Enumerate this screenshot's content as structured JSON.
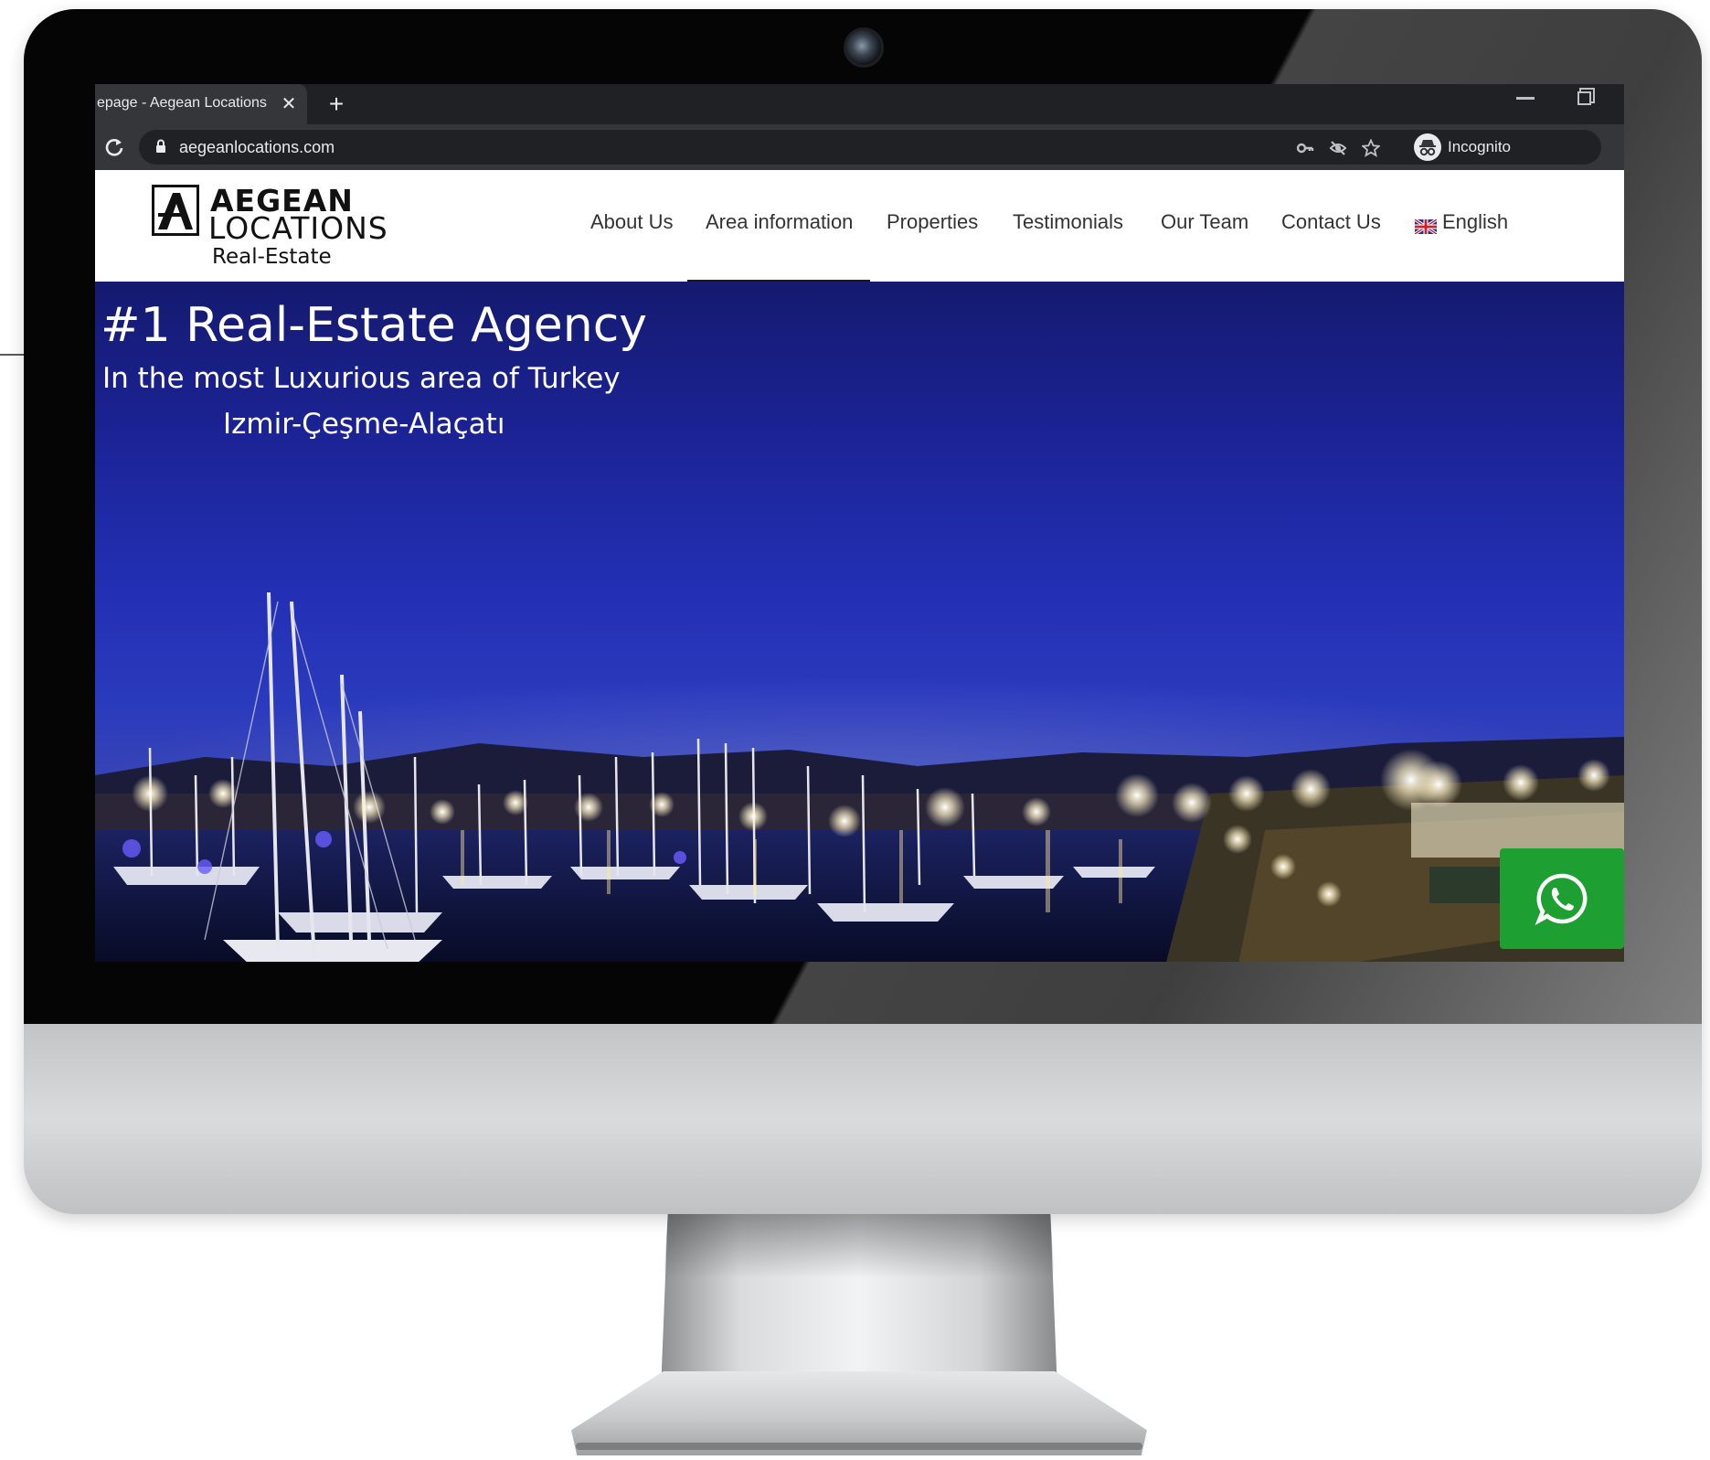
{
  "browser": {
    "tab_title": "epage - Aegean Locations - R",
    "tab_close": "✕",
    "new_tab": "+",
    "url": "aegeanlocations.com",
    "incognito_label": "Incognito",
    "icons": [
      "key-icon",
      "eye-off-icon",
      "star-icon",
      "incognito-icon",
      "reload-icon",
      "lock-icon"
    ]
  },
  "site": {
    "logo": {
      "line1": "AEGEAN",
      "line2": "LOCATIONS",
      "line3": "Real-Estate"
    },
    "nav": [
      {
        "label": "About Us"
      },
      {
        "label": "Area information"
      },
      {
        "label": "Properties"
      },
      {
        "label": "Testimonials"
      },
      {
        "label": "Our Team"
      },
      {
        "label": "Contact Us"
      },
      {
        "label": "English"
      }
    ],
    "active_nav": "Area information",
    "hero": {
      "title": "#1 Real-Estate Agency",
      "subtitle": "In the most Luxurious area of Turkey",
      "location": "Izmir-Çeşme-Alaçatı"
    }
  },
  "colors": {
    "whatsapp": "#1e9f31",
    "sky": "#2330b6",
    "bezel": "#050505"
  }
}
